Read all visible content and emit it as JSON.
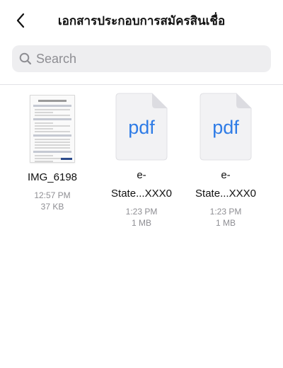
{
  "header": {
    "title": "เอกสารประกอบการสมัครสินเชื่อ",
    "back_icon": "chevron-left-icon"
  },
  "search": {
    "placeholder": "Search",
    "value": ""
  },
  "files": [
    {
      "name": "IMG_6198",
      "name_line2": "",
      "time": "12:57 PM",
      "size": "37 KB",
      "type": "image"
    },
    {
      "name": "e-",
      "name_line2": "State...XXX0",
      "time": "1:23 PM",
      "size": "1 MB",
      "type": "pdf",
      "icon_label": "pdf"
    },
    {
      "name": "e-",
      "name_line2": "State...XXX0",
      "time": "1:23 PM",
      "size": "1 MB",
      "type": "pdf",
      "icon_label": "pdf"
    }
  ],
  "colors": {
    "pdf_accent": "#2f7ce6",
    "search_bg": "#eeeef0",
    "meta_text": "#8e8e93"
  }
}
